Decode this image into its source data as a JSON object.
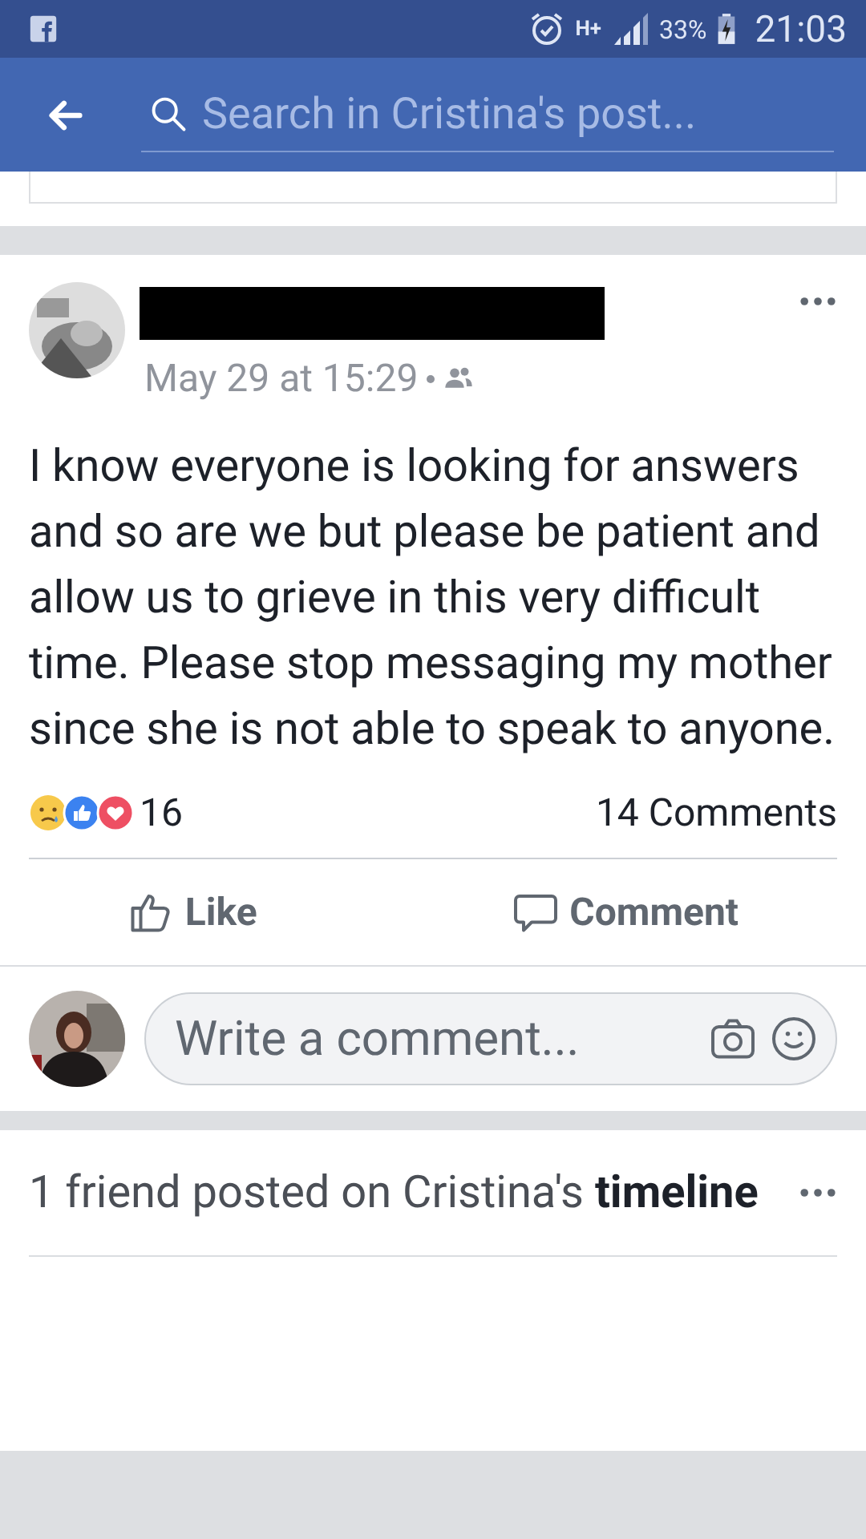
{
  "status_bar": {
    "network": "H+",
    "battery": "33%",
    "time": "21:03"
  },
  "header": {
    "search": {
      "placeholder": "Search in Cristina's post..."
    }
  },
  "post": {
    "author_redacted": true,
    "time": "May 29 at 15:29",
    "audience": {
      "kind": "friends"
    },
    "text": "I know everyone is looking for answers and so are we but please be patient and allow us to grieve in this very difficult time. Please stop messaging my mother since she is not able to speak to anyone.",
    "reactions": [
      {
        "kind": "sad"
      },
      {
        "kind": "like"
      },
      {
        "kind": "love"
      }
    ],
    "reaction_count": "16",
    "comments_count": "14 Comments",
    "actions": [
      {
        "kind": "like",
        "label": "Like"
      },
      {
        "kind": "comment",
        "label": "Comment"
      }
    ],
    "comment_box": {
      "placeholder": "Write a comment..."
    }
  },
  "friend_posts": {
    "title": "1 friend posted on Cristina's **timeline**"
  }
}
